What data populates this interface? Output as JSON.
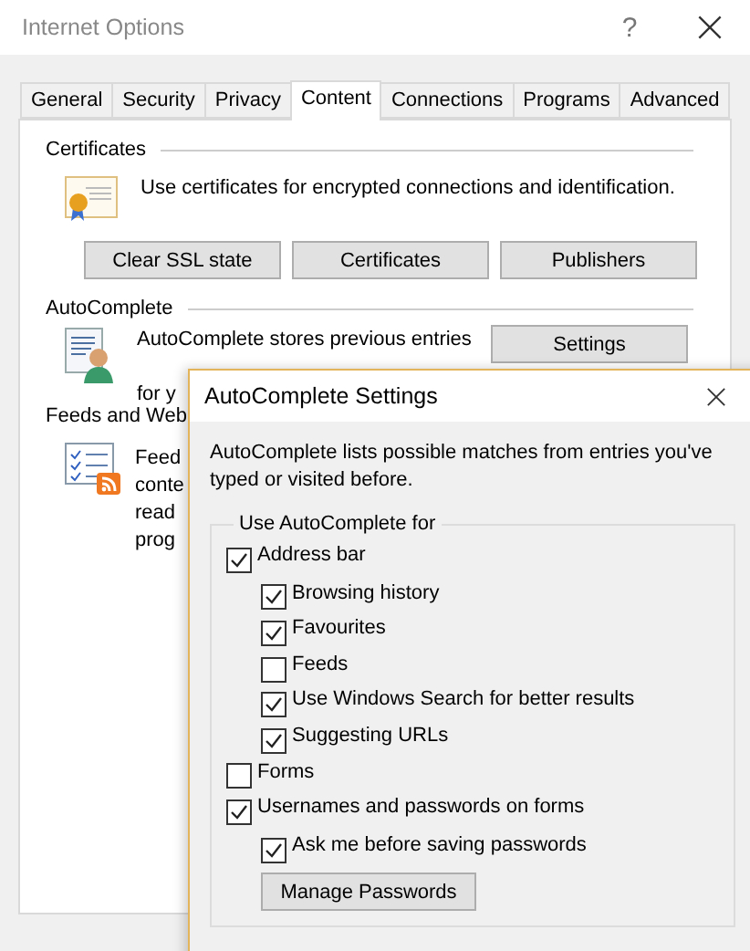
{
  "window": {
    "title": "Internet Options",
    "help": "?"
  },
  "tabs": [
    {
      "label": "General",
      "selected": false
    },
    {
      "label": "Security",
      "selected": false
    },
    {
      "label": "Privacy",
      "selected": false
    },
    {
      "label": "Content",
      "selected": true
    },
    {
      "label": "Connections",
      "selected": false
    },
    {
      "label": "Programs",
      "selected": false
    },
    {
      "label": "Advanced",
      "selected": false
    }
  ],
  "certificates": {
    "title": "Certificates",
    "description": "Use certificates for encrypted connections and identification.",
    "buttons": [
      "Clear SSL state",
      "Certificates",
      "Publishers"
    ]
  },
  "autocomplete": {
    "title": "AutoComplete",
    "lines": [
      "AutoComplete stores previous entries",
      "for y"
    ],
    "button": "Settings"
  },
  "feeds": {
    "title": "Feeds and Web",
    "lines": [
      "Feed",
      "conte",
      "read",
      "prog"
    ]
  },
  "dialog": {
    "title": "AutoComplete Settings",
    "intro": [
      "AutoComplete lists possible matches from entries you've",
      "typed or visited before."
    ],
    "group_title": "Use AutoComplete for",
    "options": [
      {
        "label": "Address bar",
        "checked": true,
        "children": [
          {
            "label": "Browsing history",
            "checked": true
          },
          {
            "label": "Favourites",
            "checked": true
          },
          {
            "label": "Feeds",
            "checked": false
          },
          {
            "label": "Use Windows Search for better results",
            "checked": true
          },
          {
            "label": "Suggesting URLs",
            "checked": true
          }
        ]
      },
      {
        "label": "Forms",
        "checked": false
      },
      {
        "label": "Usernames and passwords on forms",
        "checked": true,
        "children": [
          {
            "label": "Ask me before saving passwords",
            "checked": true
          }
        ],
        "button": "Manage Passwords"
      }
    ]
  }
}
